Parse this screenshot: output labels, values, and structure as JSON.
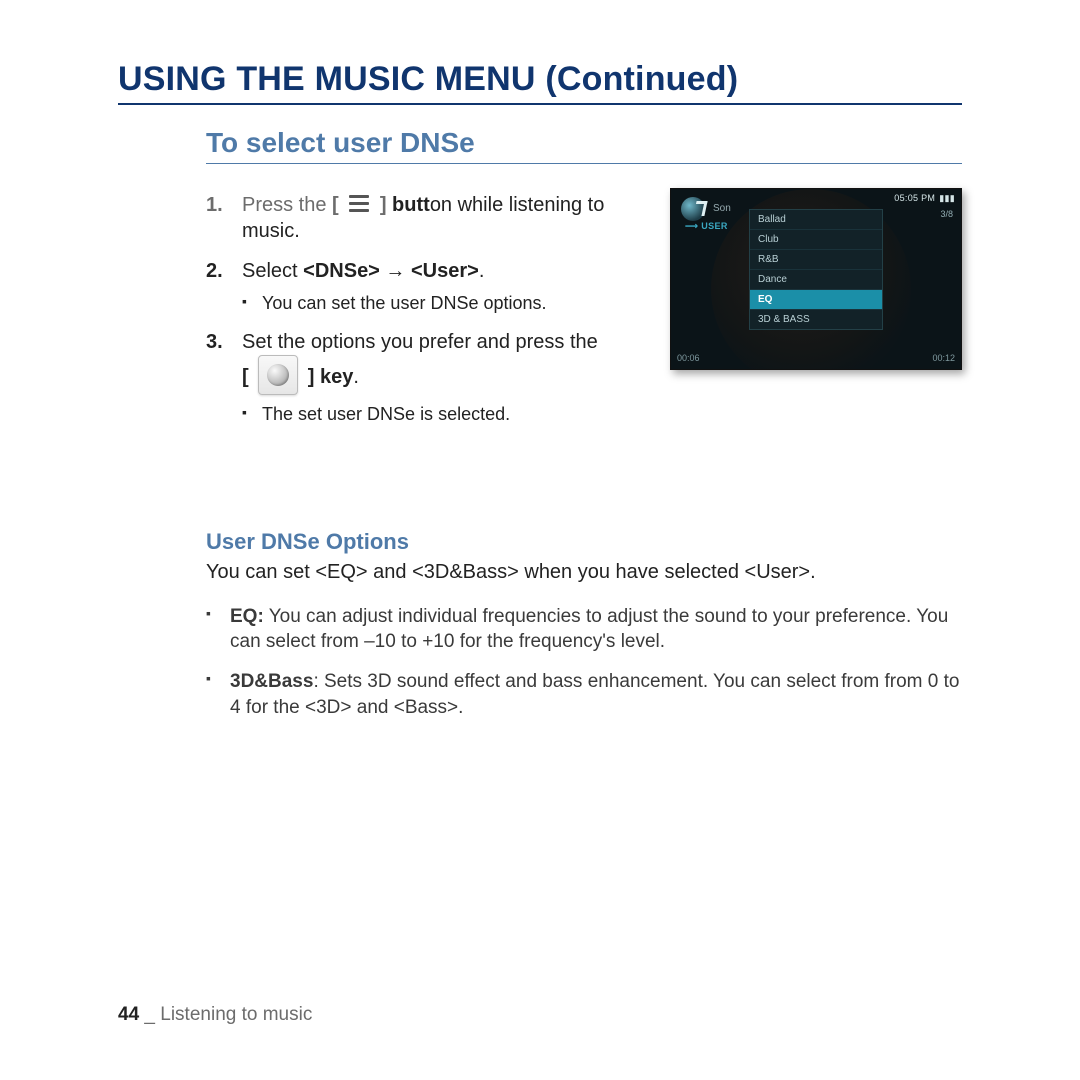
{
  "page": {
    "number": "44",
    "separator": " _ ",
    "section": "Listening to music"
  },
  "title": "USING THE MUSIC MENU (Continued)",
  "subheading": "To select user DNSe",
  "steps": [
    {
      "pre": "Press the ",
      "bracket_open": "[ ",
      "bracket_close": " ] ",
      "butt_bold": "butt",
      "post": "on while listening to music."
    },
    {
      "lead": "Select ",
      "bold": "<DNSe> → <User>",
      "tail": ".",
      "sub": "You can set the user DNSe options."
    },
    {
      "lead": "Set the options you prefer and press the",
      "key_open": "[",
      "key_close": "] key",
      "tail": ".",
      "sub": "The set user DNSe is selected."
    }
  ],
  "device": {
    "time": "05:05 PM",
    "batt": "▮▮▮",
    "side": "Son",
    "user": "USER",
    "pager": "3/8",
    "menu": [
      "Ballad",
      "Club",
      "R&B",
      "Dance",
      "EQ",
      "3D & BASS"
    ],
    "highlight": "EQ",
    "time_left": "00:06",
    "time_right": "00:12"
  },
  "options_heading": "User DNSe Options",
  "options_intro": "You can set <EQ> and <3D&Bass> when you have selected <User>.",
  "options": [
    {
      "label": "EQ:",
      "text": " You can adjust individual frequencies to adjust the sound to your preference. You can select from –10 to +10 for the frequency's level."
    },
    {
      "label": "3D&Bass",
      "text": ": Sets 3D sound effect and bass enhancement. You can select from from 0 to 4 for the <3D> and <Bass>."
    }
  ]
}
